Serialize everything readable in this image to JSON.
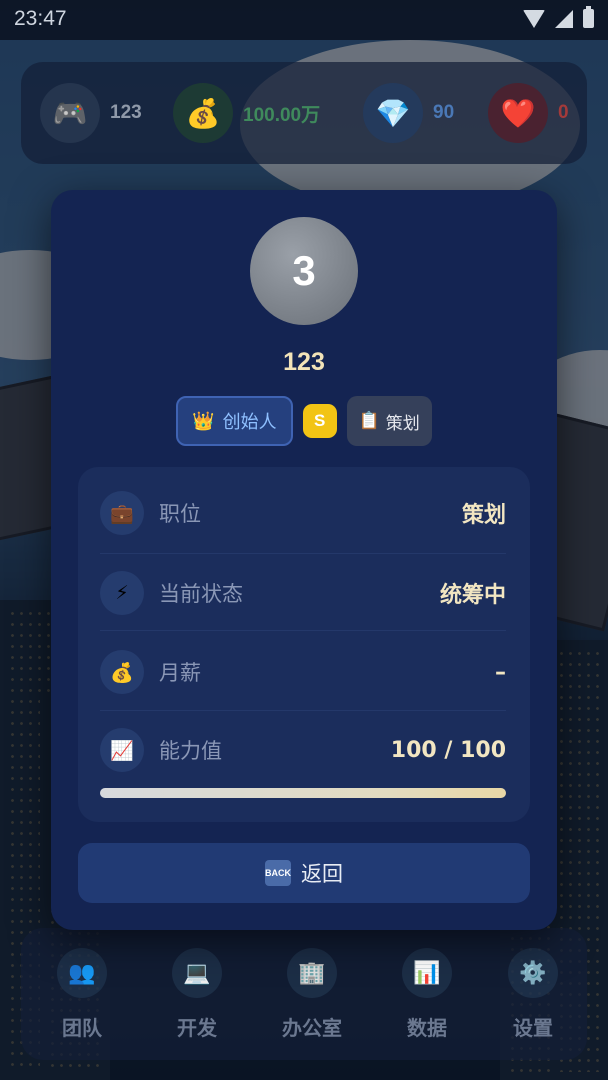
{
  "status_bar": {
    "time": "23:47"
  },
  "resources": [
    {
      "icon": "gamepad-icon",
      "glyph": "🎮",
      "value": "123",
      "value_color": "#8f99a9",
      "icon_bg": "#25354e"
    },
    {
      "icon": "money-bag-icon",
      "glyph": "💰",
      "value": "100.00万",
      "value_color": "#3f8a5c",
      "icon_bg": "#1d3a34"
    },
    {
      "icon": "diamond-icon",
      "glyph": "💎",
      "value": "90",
      "value_color": "#4a78b6",
      "icon_bg": "#243a5c"
    },
    {
      "icon": "heart-icon",
      "glyph": "❤️",
      "value": "0",
      "value_color": "#a33a3a",
      "icon_bg": "#4a2230"
    }
  ],
  "profile": {
    "avatar_text": "3",
    "name": "123",
    "badges": {
      "founder_icon": "crown-icon",
      "founder_glyph": "👑",
      "founder_label": "创始人",
      "rank": "S",
      "role_icon": "clipboard-icon",
      "role_glyph": "📋",
      "role_label": "策划"
    },
    "rows": [
      {
        "icon": "briefcase-icon",
        "glyph": "💼",
        "label": "职位",
        "value": "策划"
      },
      {
        "icon": "lightning-icon",
        "glyph": "⚡",
        "label": "当前状态",
        "value": "统筹中"
      },
      {
        "icon": "money-bag-icon",
        "glyph": "💰",
        "label": "月薪",
        "value": "–"
      },
      {
        "icon": "chart-up-icon",
        "glyph": "📈",
        "label": "能力值",
        "value": "100 / 100"
      }
    ],
    "ability_fraction": 1.0,
    "back_icon_text": "BACK",
    "back_label": "返回"
  },
  "nav": [
    {
      "icon": "team-icon",
      "glyph": "👥",
      "label": "团队"
    },
    {
      "icon": "laptop-icon",
      "glyph": "💻",
      "label": "开发"
    },
    {
      "icon": "office-building-icon",
      "glyph": "🏢",
      "label": "办公室"
    },
    {
      "icon": "bar-chart-icon",
      "glyph": "📊",
      "label": "数据"
    },
    {
      "icon": "gear-icon",
      "glyph": "⚙️",
      "label": "设置"
    }
  ]
}
